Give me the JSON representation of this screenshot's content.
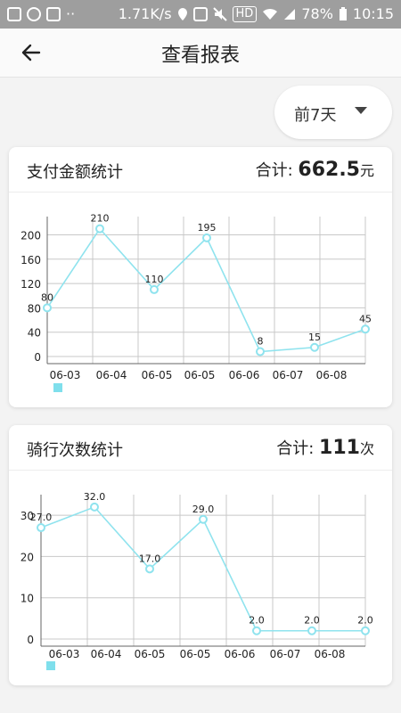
{
  "status_bar": {
    "speed": "1.71K/s",
    "hd": "HD",
    "battery": "78%",
    "time": "10:15",
    "icons": [
      "image-icon",
      "app-icon",
      "s-icon",
      "dots-icon",
      "location-icon",
      "nfc-icon",
      "mute-icon",
      "wifi-icon",
      "signal-icon",
      "battery-icon"
    ]
  },
  "header": {
    "title": "查看报表",
    "back_icon": "arrow-left-icon"
  },
  "range_select": {
    "label": "前7天",
    "icon": "caret-down-icon"
  },
  "colors": {
    "accent": "#8fe3ee",
    "grid": "#c8c8c8",
    "text": "#222222"
  },
  "payment_card": {
    "title": "支付金额统计",
    "total_label": "合计: ",
    "total_value": "662.5",
    "total_unit": "元"
  },
  "rides_card": {
    "title": "骑行次数统计",
    "total_label": "合计: ",
    "total_value": "111",
    "total_unit": "次"
  },
  "chart_data": [
    {
      "type": "line",
      "categories": [
        "06-03",
        "06-04",
        "06-05",
        "06-05",
        "06-06",
        "06-07",
        "06-08"
      ],
      "values": [
        80,
        210,
        110,
        195,
        8,
        15,
        45
      ],
      "labels": [
        "80",
        "210",
        "110",
        "195",
        "8",
        "15",
        "45"
      ],
      "yticks": [
        0,
        40,
        80,
        120,
        160,
        200
      ],
      "ylim": [
        0,
        230
      ],
      "grid": true,
      "legend": "bottom-left",
      "color": "#8fe3ee"
    },
    {
      "type": "line",
      "categories": [
        "06-03",
        "06-04",
        "06-05",
        "06-05",
        "06-06",
        "06-07",
        "06-08"
      ],
      "values": [
        27,
        32,
        17,
        29,
        2,
        2,
        2
      ],
      "labels": [
        "27.0",
        "32.0",
        "17.0",
        "29.0",
        "2.0",
        "2.0",
        "2.0"
      ],
      "yticks": [
        0,
        10,
        20,
        30
      ],
      "ylim": [
        0,
        35
      ],
      "grid": true,
      "legend": "bottom-left",
      "color": "#8fe3ee"
    }
  ]
}
